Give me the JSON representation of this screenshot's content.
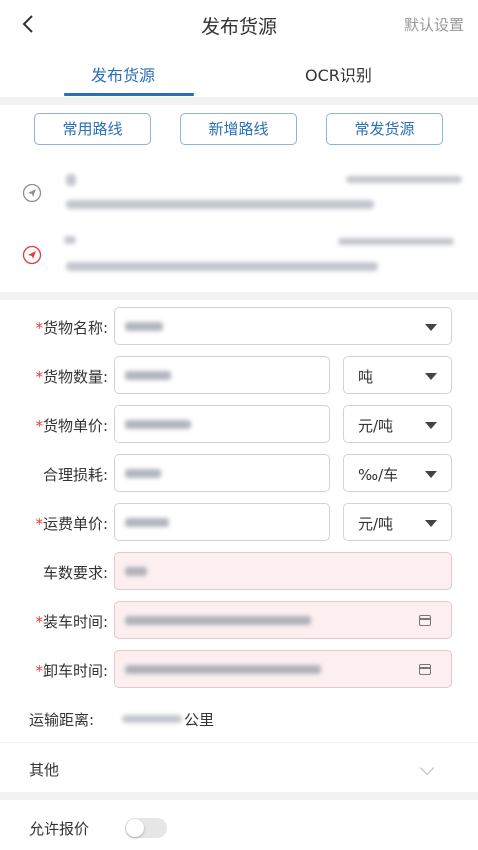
{
  "header": {
    "title": "发布货源",
    "right_action": "默认设置"
  },
  "tabs": [
    {
      "label": "发布货源",
      "active": true
    },
    {
      "label": "OCR识别",
      "active": false
    }
  ],
  "route_buttons": [
    "常用路线",
    "新增路线",
    "常发货源"
  ],
  "form": {
    "goods_name": {
      "label": "货物名称:",
      "required": true
    },
    "goods_quantity": {
      "label": "货物数量:",
      "required": true,
      "unit": "吨"
    },
    "goods_unit_price": {
      "label": "货物单价:",
      "required": true,
      "unit": "元/吨"
    },
    "reasonable_loss": {
      "label": "合理损耗:",
      "required": false,
      "unit": "‰/车"
    },
    "freight_unit_price": {
      "label": "运费单价:",
      "required": true,
      "unit": "元/吨"
    },
    "vehicle_requirement": {
      "label": "车数要求:",
      "required": false
    },
    "loading_time": {
      "label": "装车时间:",
      "required": true
    },
    "unloading_time": {
      "label": "卸车时间:",
      "required": true
    },
    "distance": {
      "label": "运输距离:",
      "unit": "公里"
    }
  },
  "other": {
    "label": "其他"
  },
  "allow_quote": {
    "label": "允许报价",
    "enabled": false
  },
  "colors": {
    "accent": "#2a6fb7",
    "required": "#e23b3b",
    "pink_field": "#fdeef0"
  },
  "required_mark": "*"
}
